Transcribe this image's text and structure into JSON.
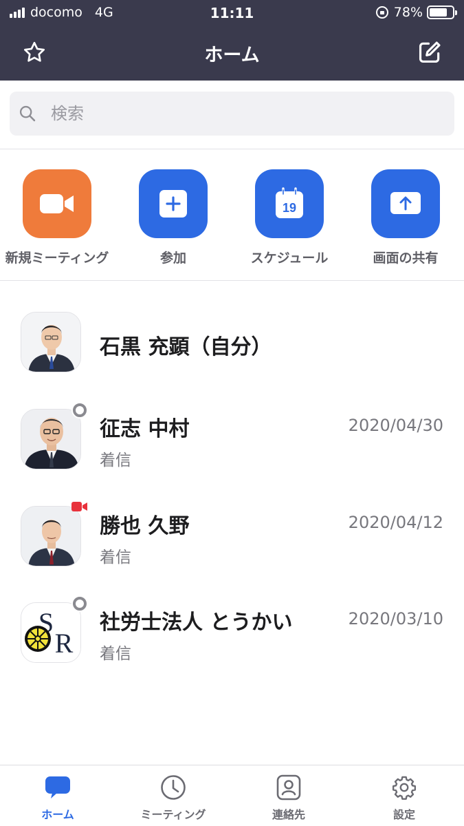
{
  "status_bar": {
    "carrier": "docomo",
    "network": "4G",
    "time": "11:11",
    "battery": "78%",
    "battery_level": 0.78
  },
  "header": {
    "title": "ホーム",
    "left_icon": "star-icon",
    "right_icon": "compose-icon"
  },
  "search": {
    "placeholder": "検索"
  },
  "actions": [
    {
      "label": "新規ミーティング",
      "icon": "video-camera-icon",
      "color": "#ef7b3b"
    },
    {
      "label": "参加",
      "icon": "plus-icon",
      "color": "#2d6ae3"
    },
    {
      "label": "スケジュール",
      "icon": "calendar-icon",
      "calendar_day": "19",
      "color": "#2d6ae3"
    },
    {
      "label": "画面の共有",
      "icon": "share-screen-icon",
      "color": "#2d6ae3"
    }
  ],
  "contacts": [
    {
      "name": "石黒 充顕（自分）",
      "subtitle": "",
      "date": "",
      "status": "none"
    },
    {
      "name": "征志 中村",
      "subtitle": "着信",
      "date": "2020/04/30",
      "status": "offline"
    },
    {
      "name": "勝也 久野",
      "subtitle": "着信",
      "date": "2020/04/12",
      "status": "in-meeting"
    },
    {
      "name": "社労士法人 とうかい",
      "subtitle": "着信",
      "date": "2020/03/10",
      "status": "offline"
    }
  ],
  "tabs": [
    {
      "label": "ホーム",
      "icon": "chat-bubble-icon",
      "active": true
    },
    {
      "label": "ミーティング",
      "icon": "clock-icon",
      "active": false
    },
    {
      "label": "連絡先",
      "icon": "contact-card-icon",
      "active": false
    },
    {
      "label": "設定",
      "icon": "gear-icon",
      "active": false
    }
  ],
  "colors": {
    "header_bg": "#3a3a4d",
    "accent": "#2d6ae3",
    "orange": "#ef7b3b",
    "meeting_red": "#e8323c"
  }
}
